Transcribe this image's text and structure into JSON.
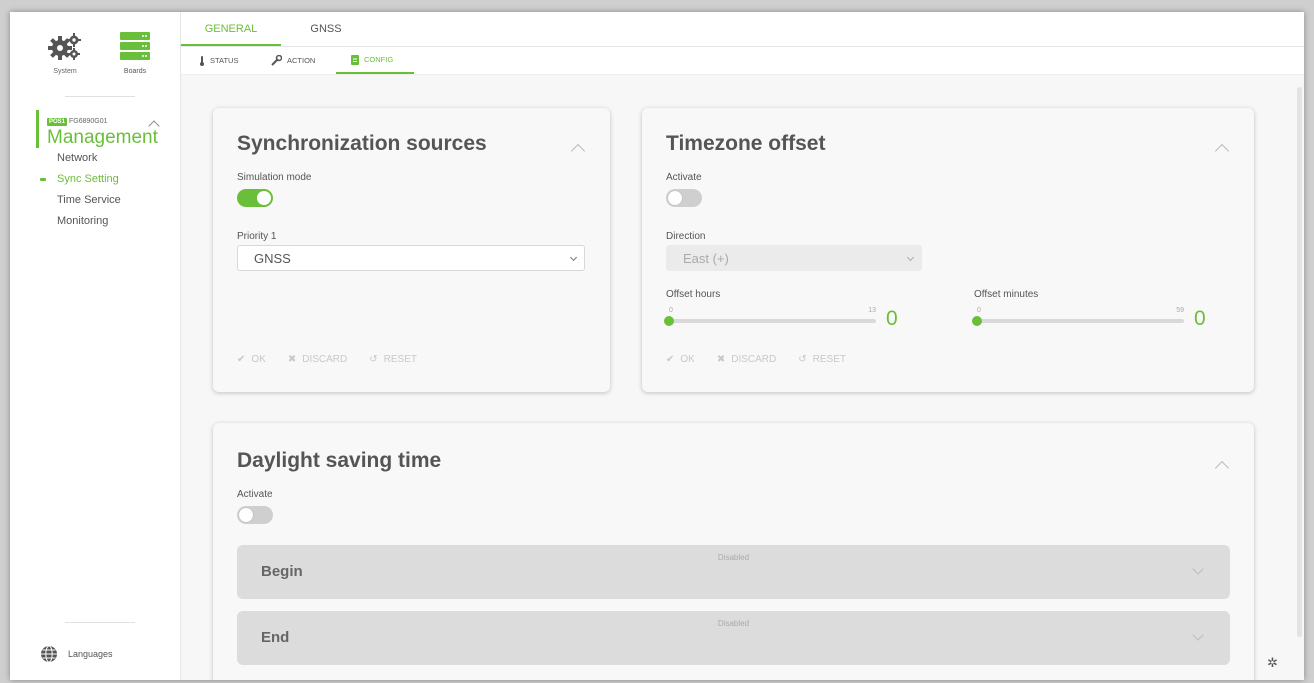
{
  "sidebar": {
    "system_label": "System",
    "boards_label": "Boards",
    "board_tag": "POS1",
    "board_code": "FG6890G01",
    "section_title": "Management",
    "items": [
      {
        "label": "Network",
        "active": false
      },
      {
        "label": "Sync Setting",
        "active": true
      },
      {
        "label": "Time Service",
        "active": false
      },
      {
        "label": "Monitoring",
        "active": false
      }
    ],
    "languages_label": "Languages"
  },
  "tabs": {
    "primary": [
      {
        "label": "GENERAL",
        "active": true
      },
      {
        "label": "GNSS",
        "active": false
      }
    ],
    "secondary": [
      {
        "label": "STATUS",
        "icon": "thermometer-icon",
        "active": false
      },
      {
        "label": "ACTION",
        "icon": "wrench-icon",
        "active": false
      },
      {
        "label": "CONFIG",
        "icon": "document-icon",
        "active": true
      }
    ]
  },
  "sync_sources": {
    "title": "Synchronization sources",
    "simulation_label": "Simulation mode",
    "simulation_on": true,
    "priority_label": "Priority 1",
    "priority_value": "GNSS",
    "ok": "OK",
    "discard": "DISCARD",
    "reset": "RESET"
  },
  "timezone": {
    "title": "Timezone offset",
    "activate_label": "Activate",
    "activate_on": false,
    "direction_label": "Direction",
    "direction_value": "East (+)",
    "hours_label": "Offset hours",
    "hours_min": "0",
    "hours_max": "13",
    "hours_value": "0",
    "minutes_label": "Offset minutes",
    "minutes_min": "0",
    "minutes_max": "59",
    "minutes_value": "0",
    "ok": "OK",
    "discard": "DISCARD",
    "reset": "RESET"
  },
  "dst": {
    "title": "Daylight saving time",
    "activate_label": "Activate",
    "activate_on": false,
    "begin_label": "Begin",
    "begin_status": "Disabled",
    "end_label": "End",
    "end_status": "Disabled"
  },
  "colors": {
    "accent": "#6abf3a",
    "text": "#555555",
    "disabled": "#c8c8c8"
  }
}
